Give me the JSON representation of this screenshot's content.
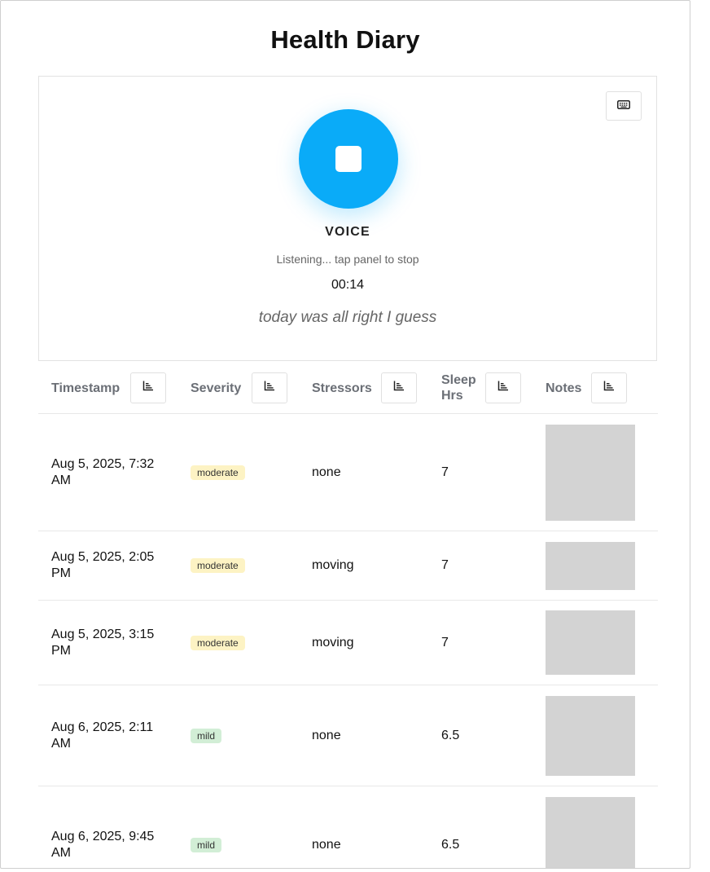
{
  "page": {
    "title": "Health Diary"
  },
  "voice": {
    "mode_label": "VOICE",
    "status": "Listening... tap panel to stop",
    "timer": "00:14",
    "transcript": "today was all right I guess",
    "accent_color": "#0aabf8",
    "keyboard_icon": "keyboard-icon",
    "record_icon": "stop-icon"
  },
  "table": {
    "columns": [
      {
        "label": "Timestamp",
        "sort_icon": "sort-icon"
      },
      {
        "label": "Severity",
        "sort_icon": "sort-icon"
      },
      {
        "label": "Stressors",
        "sort_icon": "sort-icon"
      },
      {
        "label": "Sleep Hrs",
        "sort_icon": "sort-icon"
      },
      {
        "label": "Notes",
        "sort_icon": "sort-icon"
      }
    ],
    "rows": [
      {
        "timestamp": "Aug 5, 2025, 7:32 AM",
        "severity": "moderate",
        "stressors": "none",
        "sleep": "7"
      },
      {
        "timestamp": "Aug 5, 2025, 2:05 PM",
        "severity": "moderate",
        "stressors": "moving",
        "sleep": "7"
      },
      {
        "timestamp": "Aug 5, 2025, 3:15 PM",
        "severity": "moderate",
        "stressors": "moving",
        "sleep": "7"
      },
      {
        "timestamp": "Aug 6, 2025, 2:11 AM",
        "severity": "mild",
        "stressors": "none",
        "sleep": "6.5"
      },
      {
        "timestamp": "Aug 6, 2025, 9:45 AM",
        "severity": "mild",
        "stressors": "none",
        "sleep": "6.5"
      }
    ]
  },
  "colors": {
    "moderate_badge": "#fdf3c4",
    "mild_badge": "#d2eed6",
    "notes_placeholder": "#d3d3d3"
  }
}
